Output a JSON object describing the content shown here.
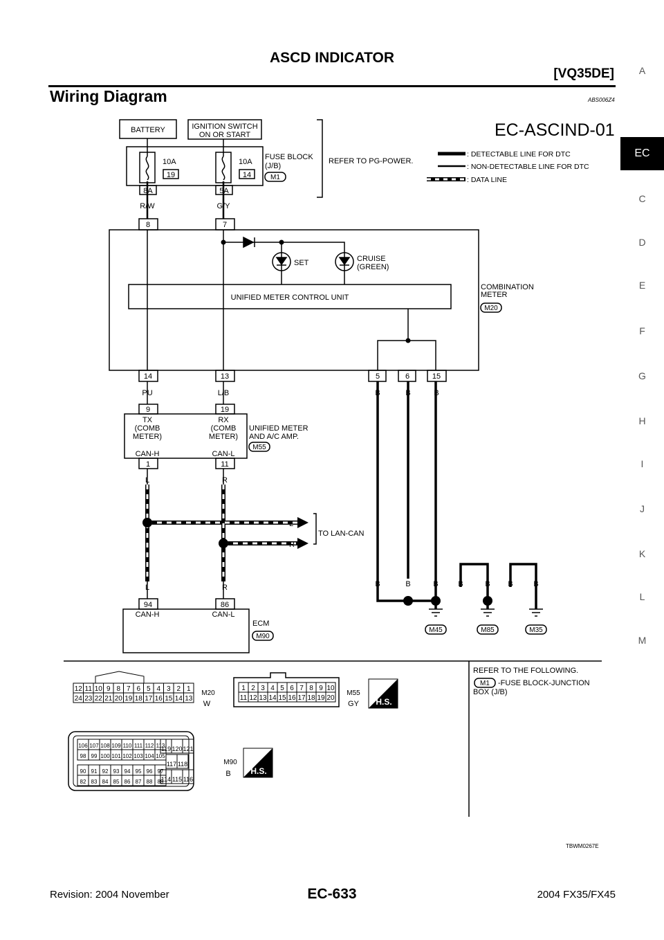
{
  "header": {
    "title": "ASCD INDICATOR",
    "engine": "[VQ35DE]",
    "section_title": "Wiring Diagram",
    "section_id": "ABS006Z4"
  },
  "sidebar": {
    "items": [
      "A",
      "EC",
      "C",
      "D",
      "E",
      "F",
      "G",
      "H",
      "I",
      "J",
      "K",
      "L",
      "M"
    ],
    "active": "EC"
  },
  "diagram": {
    "id": "EC-ASCIND-01",
    "battery": "BATTERY",
    "ignition": [
      "IGNITION SWITCH",
      "ON OR START"
    ],
    "fuses": [
      {
        "rating": "10A",
        "number": "19",
        "terminal": "8A",
        "wire": "R/W"
      },
      {
        "rating": "10A",
        "number": "14",
        "terminal": "5A",
        "wire": "G/Y"
      }
    ],
    "fuse_block": [
      "FUSE BLOCK",
      "(J/B)"
    ],
    "fuse_block_conn": "M1",
    "refer_power": "REFER TO PG-POWER.",
    "legend": [
      ": DETECTABLE LINE FOR DTC",
      ": NON-DETECTABLE LINE FOR DTC",
      ": DATA LINE"
    ],
    "meter_terms_top": [
      "8",
      "7"
    ],
    "set_label": "SET",
    "cruise_label": [
      "CRUISE",
      "(GREEN)"
    ],
    "umcu": "UNIFIED METER CONTROL UNIT",
    "comb_meter": [
      "COMBINATION",
      "METER"
    ],
    "comb_meter_conn": "M20",
    "meter_terms_bottom": [
      "14",
      "13",
      "5",
      "6",
      "15"
    ],
    "wires_mid": [
      "PU",
      "L/B",
      "B",
      "B",
      "B"
    ],
    "amp_terms_top": [
      "9",
      "19"
    ],
    "amp_left": [
      "TX",
      "(COMB",
      "METER)"
    ],
    "amp_right": [
      "RX",
      "(COMB",
      "METER)"
    ],
    "amp_can": [
      "CAN-H",
      "CAN-L"
    ],
    "amp_name": [
      "UNIFIED METER",
      "AND A/C AMP."
    ],
    "amp_conn": "M55",
    "amp_terms_bottom": [
      "1",
      "11"
    ],
    "can_wires": [
      "L",
      "R"
    ],
    "lan_labels": [
      "L",
      "R"
    ],
    "to_lan": "TO LAN-CAN",
    "ecm_terms": [
      "94",
      "86"
    ],
    "ecm_can": [
      "CAN-H",
      "CAN-L"
    ],
    "ecm_name": "ECM",
    "ecm_conn": "M90",
    "ground_wires": [
      "B",
      "B",
      "B",
      "B",
      "B",
      "B",
      "B"
    ],
    "grounds": [
      "M45",
      "M85",
      "M35"
    ]
  },
  "connectors": {
    "m20": {
      "id": "M20",
      "color": "W",
      "row1": [
        "12",
        "11",
        "10",
        "9",
        "8",
        "7",
        "6",
        "5",
        "4",
        "3",
        "2",
        "1"
      ],
      "row2": [
        "24",
        "23",
        "22",
        "21",
        "20",
        "19",
        "18",
        "17",
        "16",
        "15",
        "14",
        "13"
      ]
    },
    "m55": {
      "id": "M55",
      "color": "GY",
      "row1": [
        "1",
        "2",
        "3",
        "4",
        "5",
        "6",
        "7",
        "8",
        "9",
        "10"
      ],
      "row2": [
        "11",
        "12",
        "13",
        "14",
        "15",
        "16",
        "17",
        "18",
        "19",
        "20"
      ]
    },
    "m90": {
      "id": "M90",
      "color": "B",
      "rows": [
        [
          "106",
          "107",
          "108",
          "109",
          "110",
          "111",
          "112",
          "113"
        ],
        [
          "98",
          "99",
          "100",
          "101",
          "102",
          "103",
          "104",
          "105"
        ],
        [
          "90",
          "91",
          "92",
          "93",
          "94",
          "95",
          "96",
          "97"
        ],
        [
          "82",
          "83",
          "84",
          "85",
          "86",
          "87",
          "88",
          "89"
        ]
      ],
      "right_top": [
        "119",
        "120",
        "121"
      ],
      "right_mid": [
        "117",
        "118"
      ],
      "right_bottom": [
        "114",
        "115",
        "116"
      ]
    },
    "hs_label": "H.S."
  },
  "refer": {
    "title": "REFER TO THE FOLLOWING.",
    "conn": "M1",
    "text": "-FUSE BLOCK-JUNCTION",
    "text2": "BOX (J/B)"
  },
  "figure_id": "TBWM0267E",
  "footer": {
    "revision": "Revision: 2004 November",
    "page": "EC-633",
    "model": "2004 FX35/FX45"
  }
}
